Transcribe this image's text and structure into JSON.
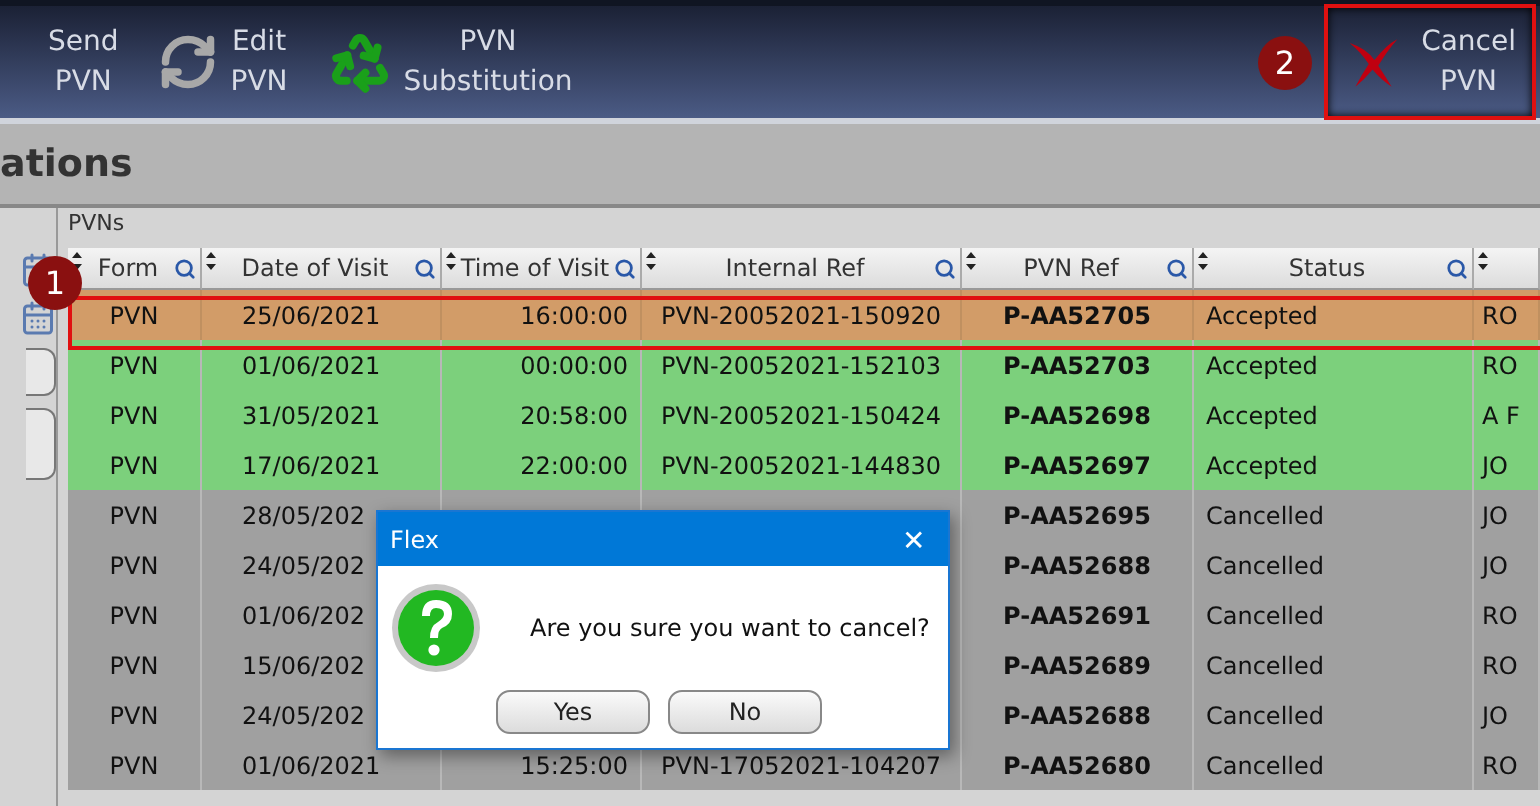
{
  "toolbar": {
    "buttons": [
      {
        "label": "Send\nPVN",
        "highlighted": false
      },
      {
        "label": "Edit\nPVN",
        "highlighted": false
      },
      {
        "label": "PVN\nSubstitution",
        "highlighted": false
      }
    ],
    "right_button": {
      "label": "Cancel\nPVN",
      "highlighted": true
    },
    "marker": "2"
  },
  "page_title": "ations",
  "group_label": "PVNs",
  "table": {
    "columns": [
      "Form",
      "Date of Visit",
      "Time of Visit",
      "Internal Ref",
      "PVN Ref",
      "Status",
      null
    ],
    "marker": "1",
    "rows": [
      {
        "selected": true,
        "color": "#d29c68",
        "cells": [
          "PVN",
          "25/06/2021",
          "16:00:00",
          "PVN-20052021-150920",
          "P-AA52705",
          "Accepted",
          "RO"
        ]
      },
      {
        "selected": false,
        "color": "#7cd07c",
        "cells": [
          "PVN",
          "01/06/2021",
          "00:00:00",
          "PVN-20052021-152103",
          "P-AA52703",
          "Accepted",
          "RO"
        ]
      },
      {
        "selected": false,
        "color": "#7cd07c",
        "cells": [
          "PVN",
          "31/05/2021",
          "20:58:00",
          "PVN-20052021-150424",
          "P-AA52698",
          "Accepted",
          "A F"
        ]
      },
      {
        "selected": false,
        "color": "#7cd07c",
        "cells": [
          "PVN",
          "17/06/2021",
          "22:00:00",
          "PVN-20052021-144830",
          "P-AA52697",
          "Accepted",
          "JO"
        ]
      },
      {
        "selected": false,
        "color": "#a0a0a0",
        "cells": [
          "PVN",
          "28/05/202",
          null,
          null,
          "P-AA52695",
          "Cancelled",
          "JO"
        ]
      },
      {
        "selected": false,
        "color": "#a0a0a0",
        "cells": [
          "PVN",
          "24/05/202",
          null,
          null,
          "P-AA52688",
          "Cancelled",
          "JO"
        ]
      },
      {
        "selected": false,
        "color": "#a0a0a0",
        "cells": [
          "PVN",
          "01/06/202",
          null,
          null,
          "P-AA52691",
          "Cancelled",
          "RO"
        ]
      },
      {
        "selected": false,
        "color": "#a0a0a0",
        "cells": [
          "PVN",
          "15/06/202",
          null,
          null,
          "P-AA52689",
          "Cancelled",
          "RO"
        ]
      },
      {
        "selected": false,
        "color": "#a0a0a0",
        "cells": [
          "PVN",
          "24/05/202",
          null,
          null,
          "P-AA52688",
          "Cancelled",
          "JO"
        ]
      },
      {
        "selected": false,
        "color": "#a0a0a0",
        "cells": [
          "PVN",
          "01/06/2021",
          "15:25:00",
          "PVN-17052021-104207",
          "P-AA52680",
          "Cancelled",
          "RO"
        ]
      }
    ]
  },
  "dialog": {
    "title": "Flex",
    "close": "✕",
    "message": "Are you sure you want to cancel?",
    "buttons": [
      "Yes",
      "No"
    ]
  }
}
